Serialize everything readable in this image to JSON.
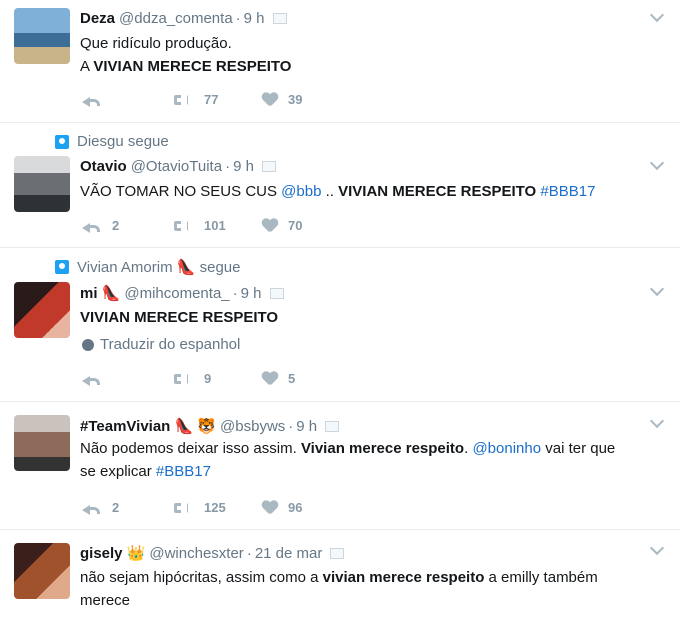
{
  "tweets": [
    {
      "social": "",
      "name": "Deza",
      "handle": "@ddza_comenta",
      "time": "9 h",
      "lines": [
        "Que ridículo produção.",
        "A "
      ],
      "bold": "VIVIAN MERECE RESPEITO",
      "reply_count": "",
      "retweet_count": "77",
      "like_count": "39",
      "avatar_color": "#4a7fb3"
    },
    {
      "social": "Diesgu segue",
      "name": "Otavio",
      "handle": "@OtavioTuita",
      "time": "9 h",
      "text_a": "VÃO TOMAR NO SEUS CUS ",
      "mention": "@bbb",
      "text_b": " .. ",
      "bold": "VIVIAN MERECE RESPEITO",
      "hashtag": "#BBB17",
      "reply_count": "2",
      "retweet_count": "101",
      "like_count": "70",
      "avatar_color": "#6b6e73"
    },
    {
      "social": "Vivian Amorim 👠 segue",
      "name": "mi 👠",
      "handle": "@mihcomenta_",
      "time": "9 h",
      "bold": "VIVIAN MERECE RESPEITO",
      "translate": "Traduzir do espanhol",
      "reply_count": "",
      "retweet_count": "9",
      "like_count": "5",
      "avatar_color": "#c0392b"
    },
    {
      "social": "",
      "name": "#TeamVivian 👠 🐯",
      "handle": "@bsbyws",
      "time": "9 h",
      "text_a": "Não podemos deixar isso assim. ",
      "bold": "Vivian merece respeito",
      "text_b": ". ",
      "mention": "@boninho",
      "text_c": "  vai ter que",
      "line2_a": "se explicar ",
      "hashtag": "#BBB17",
      "reply_count": "2",
      "retweet_count": "125",
      "like_count": "96",
      "avatar_color": "#8e6a5a"
    },
    {
      "social": "",
      "name": "gisely 👑",
      "handle": "@winchesxter",
      "time": "21 de mar",
      "text_a": "não sejam hipócritas, assim como a ",
      "bold": "vivian merece respeito",
      "text_b": " a emilly também",
      "line2": "merece",
      "avatar_color": "#a0522d"
    }
  ],
  "colors": {
    "accent": "#1da1f2",
    "link": "#1b6ec9",
    "muted": "#657786"
  }
}
